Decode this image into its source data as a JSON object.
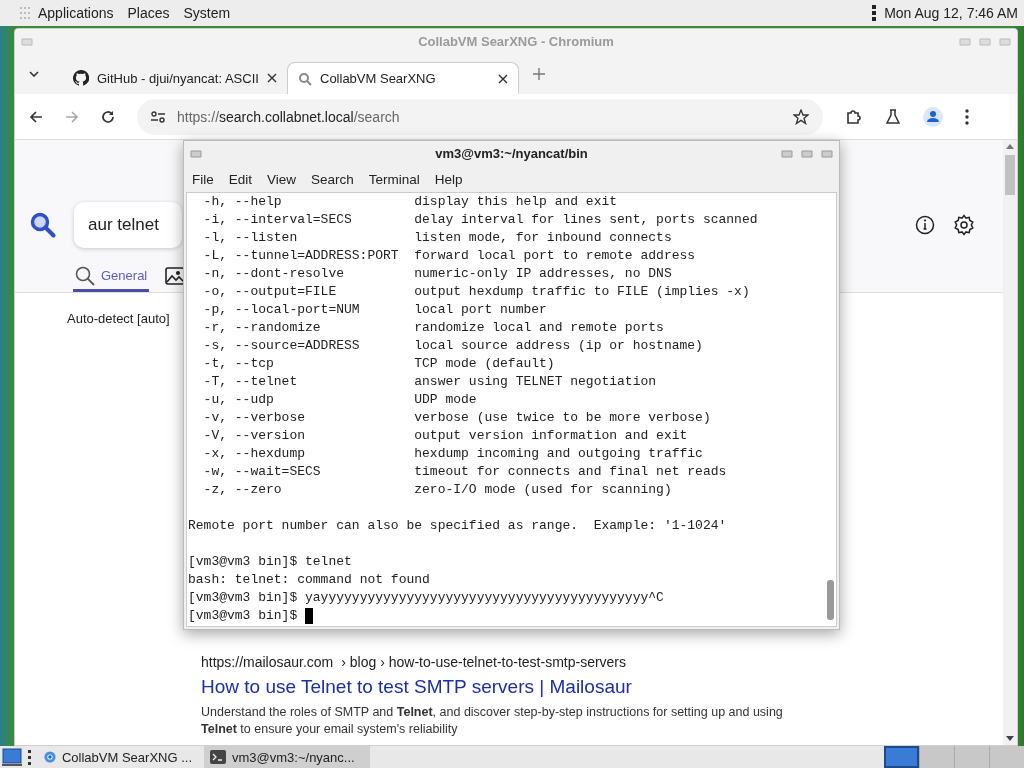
{
  "top_panel": {
    "menus": [
      "Applications",
      "Places",
      "System"
    ],
    "clock": "Mon Aug 12, 7:46 AM"
  },
  "browser": {
    "title": "CollabVM SearXNG - Chromium",
    "tabs": [
      {
        "label": "GitHub - djui/nyancat: ASCII",
        "kind": "github",
        "selected": false
      },
      {
        "label": "CollabVM SearXNG",
        "kind": "searxng",
        "selected": true
      }
    ],
    "forward_disabled": true,
    "address": {
      "scheme": "https://",
      "host": "search.collabnet.local",
      "path": "/search"
    },
    "page": {
      "query": "aur telnet",
      "categories": [
        {
          "label": "General",
          "kind": "general",
          "selected": true
        },
        {
          "kind": "images",
          "selected": false
        }
      ],
      "language": "Auto-detect [auto]",
      "result": {
        "url": "https://mailosaur.com",
        "breadcrumb": "› blog › how-to-use-telnet-to-test-smtp-servers",
        "title": "How to use Telnet to test SMTP servers | Mailosaur",
        "snippet": "Understand the roles of SMTP and **Telnet**, and discover step-by-step instructions for setting up and using **Telnet** to ensure your email system's reliability"
      }
    }
  },
  "terminal": {
    "title": "vm3@vm3:~/nyancat/bin",
    "menus": [
      "File",
      "Edit",
      "View",
      "Search",
      "Terminal",
      "Help"
    ],
    "lines": [
      {
        "kind": "option",
        "flag": "-h, --help",
        "desc": "display this help and exit"
      },
      {
        "kind": "option",
        "flag": "-i, --interval=SECS",
        "desc": "delay interval for lines sent, ports scanned"
      },
      {
        "kind": "option",
        "flag": "-l, --listen",
        "desc": "listen mode, for inbound connects"
      },
      {
        "kind": "option",
        "flag": "-L, --tunnel=ADDRESS:PORT",
        "desc": "forward local port to remote address"
      },
      {
        "kind": "option",
        "flag": "-n, --dont-resolve",
        "desc": "numeric-only IP addresses, no DNS"
      },
      {
        "kind": "option",
        "flag": "-o, --output=FILE",
        "desc": "output hexdump traffic to FILE (implies -x)"
      },
      {
        "kind": "option",
        "flag": "-p, --local-port=NUM",
        "desc": "local port number"
      },
      {
        "kind": "option",
        "flag": "-r, --randomize",
        "desc": "randomize local and remote ports"
      },
      {
        "kind": "option",
        "flag": "-s, --source=ADDRESS",
        "desc": "local source address (ip or hostname)"
      },
      {
        "kind": "option",
        "flag": "-t, --tcp",
        "desc": "TCP mode (default)"
      },
      {
        "kind": "option",
        "flag": "-T, --telnet",
        "desc": "answer using TELNET negotiation"
      },
      {
        "kind": "option",
        "flag": "-u, --udp",
        "desc": "UDP mode"
      },
      {
        "kind": "option",
        "flag": "-v, --verbose",
        "desc": "verbose (use twice to be more verbose)"
      },
      {
        "kind": "option",
        "flag": "-V, --version",
        "desc": "output version information and exit"
      },
      {
        "kind": "option",
        "flag": "-x, --hexdump",
        "desc": "hexdump incoming and outgoing traffic"
      },
      {
        "kind": "option",
        "flag": "-w, --wait=SECS",
        "desc": "timeout for connects and final net reads"
      },
      {
        "kind": "option",
        "flag": "-z, --zero",
        "desc": "zero-I/O mode (used for scanning)"
      },
      {
        "kind": "blank"
      },
      {
        "kind": "text",
        "text": "Remote port number can also be specified as range.  Example: '1-1024'"
      },
      {
        "kind": "blank"
      },
      {
        "kind": "text",
        "text": "[vm3@vm3 bin]$ telnet"
      },
      {
        "kind": "text",
        "text": "bash: telnet: command not found"
      },
      {
        "kind": "text",
        "text": "[vm3@vm3 bin]$ yayyyyyyyyyyyyyyyyyyyyyyyyyyyyyyyyyyyyyyyyyy^C"
      },
      {
        "kind": "prompt",
        "text": "[vm3@vm3 bin]$",
        "cursor": true
      }
    ]
  },
  "taskbar": {
    "tasks": [
      {
        "label": "CollabVM SearXNG ...",
        "kind": "browser",
        "selected": false
      },
      {
        "label": "vm3@vm3:~/nyanc...",
        "kind": "terminal",
        "selected": true
      }
    ],
    "workspaces": [
      {
        "selected": true
      },
      {
        "selected": false
      },
      {
        "selected": false
      },
      {
        "selected": false
      }
    ]
  }
}
